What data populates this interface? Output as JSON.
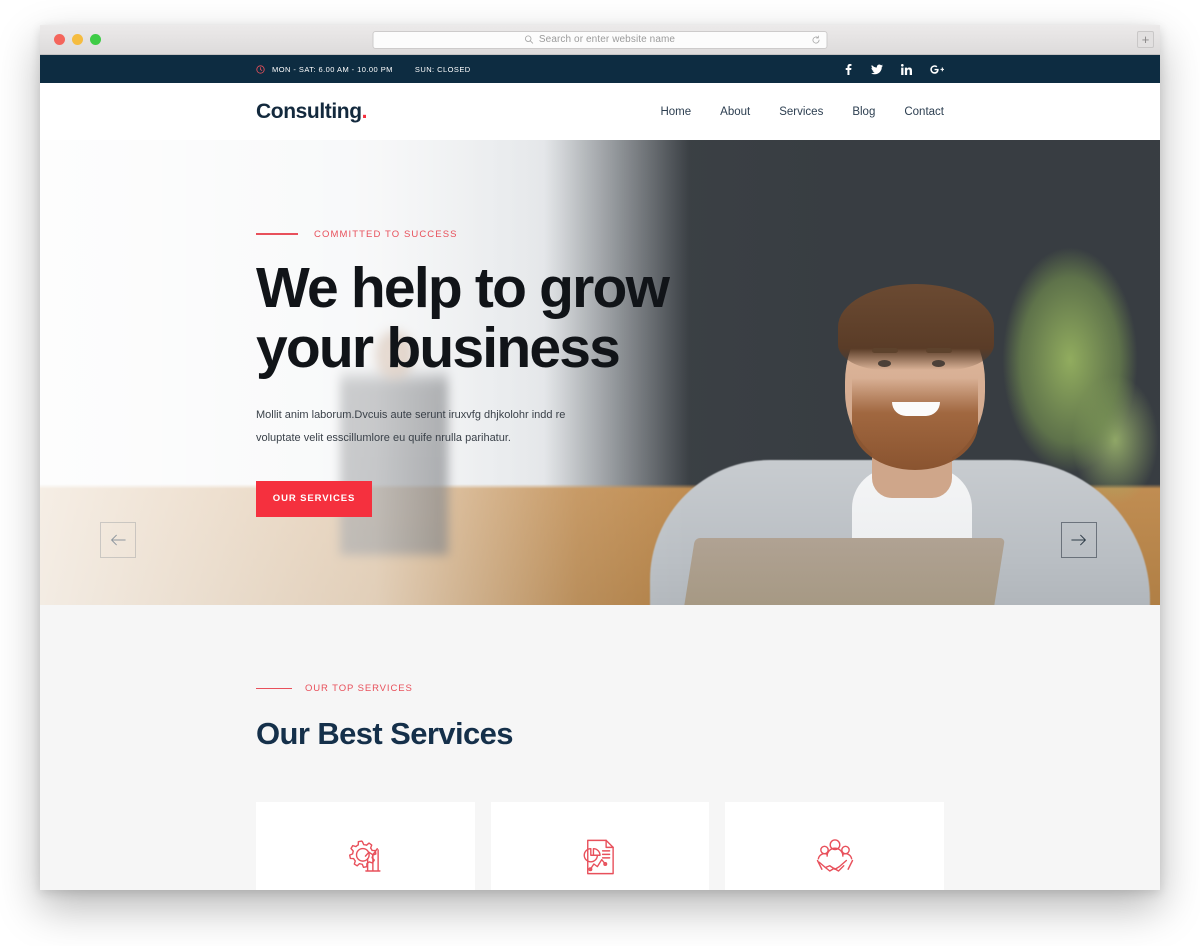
{
  "browser": {
    "traffic_lights": [
      "close",
      "minimize",
      "maximize"
    ],
    "address_placeholder": "Search or enter website name",
    "address_value": "",
    "reload_icon": "reload-icon",
    "search_icon": "search-icon",
    "newtab_label": "+"
  },
  "topbar": {
    "clock_icon": "clock-icon",
    "hours_weekday": "MON - SAT: 6.00 AM - 10.00 PM",
    "hours_sunday": "SUN: CLOSED",
    "socials": [
      {
        "name": "facebook",
        "icon": "facebook-icon"
      },
      {
        "name": "twitter",
        "icon": "twitter-icon"
      },
      {
        "name": "linkedin",
        "icon": "linkedin-icon"
      },
      {
        "name": "googleplus",
        "icon": "google-plus-icon"
      }
    ],
    "bg_color": "#0d2c41"
  },
  "header": {
    "logo_text": "Consulting",
    "logo_dot": ".",
    "nav": [
      {
        "label": "Home"
      },
      {
        "label": "About"
      },
      {
        "label": "Services"
      },
      {
        "label": "Blog"
      },
      {
        "label": "Contact"
      }
    ]
  },
  "hero": {
    "eyebrow": "COMMITTED TO SUCCESS",
    "title_line1": "We help to grow",
    "title_line2": "your business",
    "paragraph": "Mollit anim laborum.Dvcuis aute serunt iruxvfg dhjkolohr indd re voluptate velit esscillumlore eu quife nrulla parihatur.",
    "cta_label": "OUR SERVICES",
    "prev_icon": "arrow-left-icon",
    "next_icon": "arrow-right-icon",
    "accent_color": "#f5303e"
  },
  "services": {
    "eyebrow": "OUR TOP SERVICES",
    "title": "Our Best Services",
    "bg_color": "#f6f6f6",
    "cards": [
      {
        "icon": "gear-chart-icon"
      },
      {
        "icon": "document-piechart-icon"
      },
      {
        "icon": "handshake-icon"
      }
    ]
  },
  "colors": {
    "accent_red": "#f5303e",
    "eyebrow_red": "#e8505b",
    "dark_navy": "#0d2c41",
    "heading_navy": "#15304a"
  }
}
